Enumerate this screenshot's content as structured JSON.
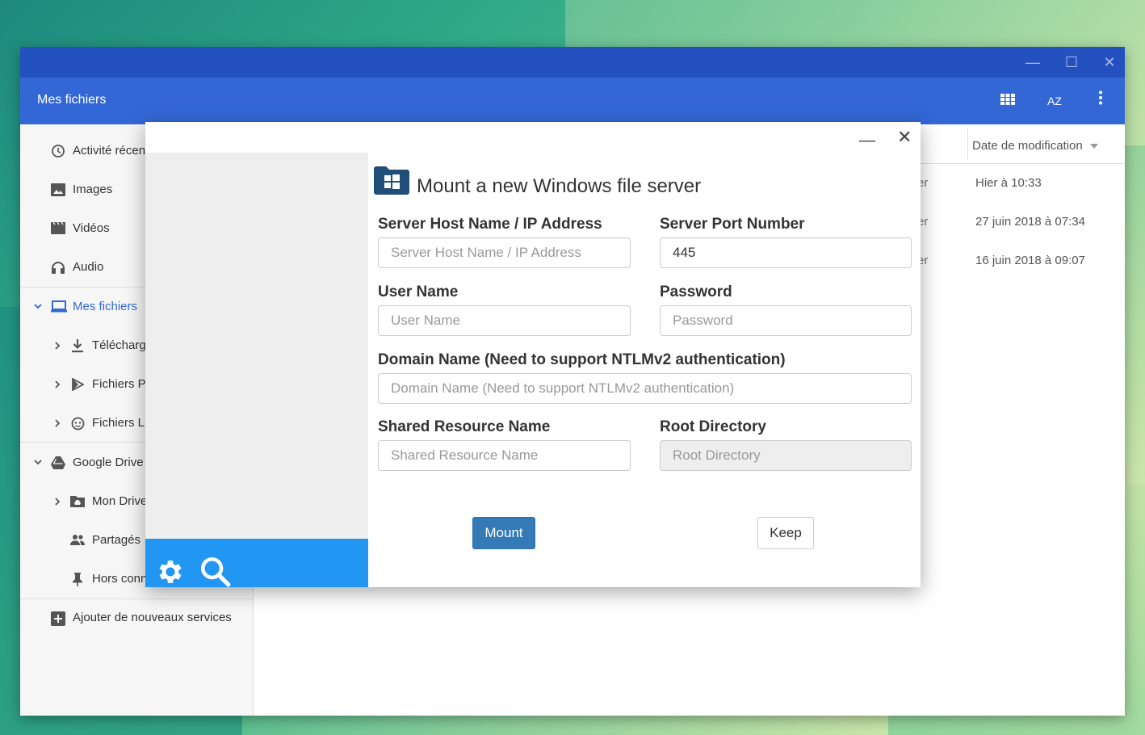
{
  "window": {
    "title": "Mes fichiers",
    "controls": {
      "minimize": "—",
      "maximize": "☐",
      "close": "✕"
    },
    "toolbar": {
      "grid_icon": "grid-view-icon",
      "sort_label": "AZ",
      "more_icon": "more-vert-icon"
    }
  },
  "sidebar": {
    "items": [
      {
        "label": "Activité récen",
        "icon": "clock-icon"
      },
      {
        "label": "Images",
        "icon": "image-icon"
      },
      {
        "label": "Vidéos",
        "icon": "video-icon"
      },
      {
        "label": "Audio",
        "icon": "headphones-icon"
      },
      {
        "label": "Mes fichiers",
        "icon": "laptop-icon"
      },
      {
        "label": "Télécharg",
        "icon": "download-icon"
      },
      {
        "label": "Fichiers P",
        "icon": "play-icon"
      },
      {
        "label": "Fichiers L",
        "icon": "linux-icon"
      },
      {
        "label": "Google Drive",
        "icon": "drive-icon"
      },
      {
        "label": "Mon Drive",
        "icon": "drive-folder-icon"
      },
      {
        "label": "Partagés",
        "icon": "people-icon"
      },
      {
        "label": "Hors conn",
        "icon": "pin-icon"
      },
      {
        "label": "Ajouter de nouveaux services",
        "icon": "add-box-icon"
      }
    ]
  },
  "file_list": {
    "column_header": "Date de modification",
    "rows": [
      {
        "type_fragment": "er",
        "date": "Hier à 10:33"
      },
      {
        "type_fragment": "er",
        "date": "27 juin 2018 à 07:34"
      },
      {
        "type_fragment": "er",
        "date": "16 juin 2018 à 09:07"
      }
    ]
  },
  "dialog": {
    "title": "Mount a new Windows file server",
    "fields": {
      "host": {
        "label": "Server Host Name / IP Address",
        "placeholder": "Server Host Name / IP Address",
        "value": ""
      },
      "port": {
        "label": "Server Port Number",
        "placeholder": "",
        "value": "445"
      },
      "user": {
        "label": "User Name",
        "placeholder": "User Name",
        "value": ""
      },
      "password": {
        "label": "Password",
        "placeholder": "Password",
        "value": ""
      },
      "domain": {
        "label": "Domain Name (Need to support NTLMv2 authentication)",
        "placeholder": "Domain Name (Need to support NTLMv2 authentication)",
        "value": ""
      },
      "share": {
        "label": "Shared Resource Name",
        "placeholder": "Shared Resource Name",
        "value": ""
      },
      "root": {
        "label": "Root Directory",
        "placeholder": "Root Directory",
        "value": ""
      }
    },
    "buttons": {
      "mount": "Mount",
      "keep": "Keep"
    },
    "controls": {
      "minimize": "—",
      "close": "✕"
    },
    "bottombar": {
      "settings_icon": "gear-icon",
      "search_icon": "search-icon"
    }
  }
}
